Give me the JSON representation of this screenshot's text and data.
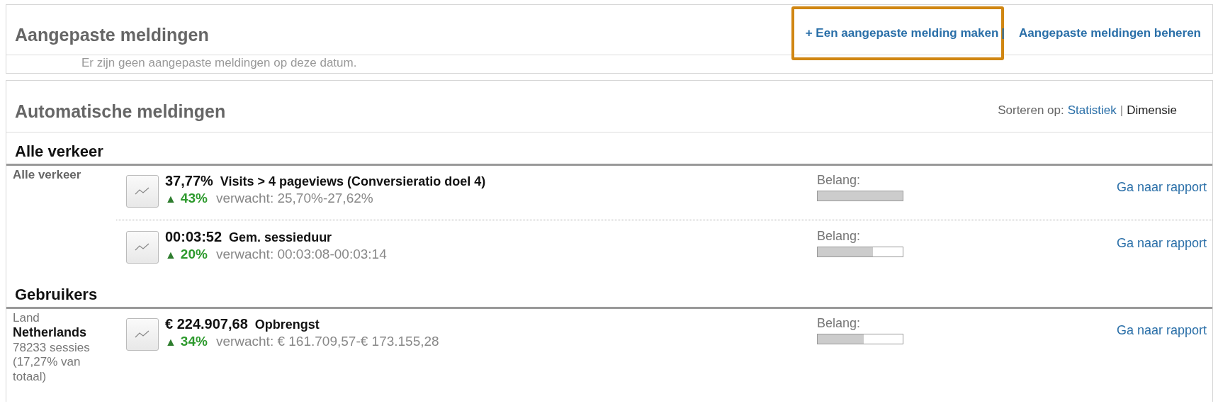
{
  "custom_alerts": {
    "title": "Aangepaste meldingen",
    "links": [
      {
        "label": "+ Een aangepaste melding maken",
        "highlighted": true
      },
      {
        "label": "Aangepaste meldingen beheren",
        "highlighted": false
      }
    ],
    "separator": "|",
    "empty_message": "Er zijn geen aangepaste meldingen op deze datum."
  },
  "automatic_alerts": {
    "title": "Automatische meldingen",
    "sort_label": "Sorteren op:",
    "sort_options": [
      {
        "label": "Statistiek",
        "selected": false
      },
      {
        "label": "Dimensie",
        "selected": true
      }
    ],
    "sort_separator": "|",
    "groups": [
      {
        "title": "Alle verkeer",
        "segment": {
          "label": "Alle verkeer"
        },
        "alerts": [
          {
            "value": "37,77%",
            "metric": "Visits > 4 pageviews (Conversieratio doel 4)",
            "arrow": "▲",
            "change": "43%",
            "expected": "verwacht: 25,70%-27,62%",
            "importance_label": "Belang:",
            "level": 1.0,
            "link": "Ga naar rapport"
          },
          {
            "value": "00:03:52",
            "metric": "Gem. sessieduur",
            "arrow": "▲",
            "change": "20%",
            "expected": "verwacht: 00:03:08-00:03:14",
            "importance_label": "Belang:",
            "level": 0.65,
            "link": "Ga naar rapport"
          }
        ]
      },
      {
        "title": "Gebruikers",
        "segment": {
          "label": "Land",
          "name": "Netherlands",
          "detail": "78233 sessies (17,27% van totaal)"
        },
        "alerts": [
          {
            "value": "€ 224.907,68",
            "metric": "Opbrengst",
            "arrow": "▲",
            "change": "34%",
            "expected": "verwacht: € 161.709,57-€ 173.155,28",
            "importance_label": "Belang:",
            "level": 0.54,
            "link": "Ga naar rapport"
          }
        ]
      }
    ]
  }
}
